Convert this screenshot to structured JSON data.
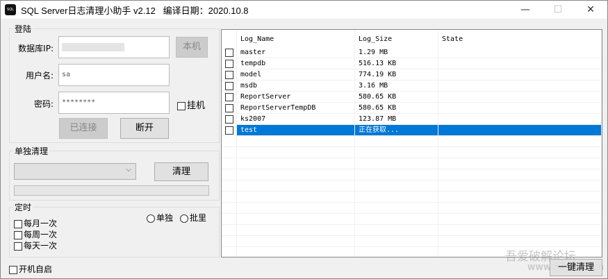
{
  "window": {
    "title": "SQL Server日志清理小助手 v2.12   编译日期：2020.10.8",
    "icon_text": "SQL",
    "minimize": "—",
    "maximize": "☐",
    "close": "✕"
  },
  "login": {
    "group": "登陆",
    "ip_label": "数据库IP:",
    "ip_value": "",
    "local_button": "本机",
    "user_label": "用户名:",
    "user_value": "sa",
    "pwd_label": "密码:",
    "pwd_value": "********",
    "hang_label": "挂机",
    "connected_button": "已连接",
    "disconnect_button": "断开"
  },
  "single": {
    "group": "单独清理",
    "select_value": "",
    "clean_button": "清理",
    "progress": 0
  },
  "timer": {
    "group": "定时",
    "monthly": "每月一次",
    "weekly": "每周一次",
    "daily": "每天一次",
    "radio_single": "单独",
    "radio_batch": "批里"
  },
  "autostart": "开机自启",
  "one_click_button": "一键清理",
  "watermark": "吾爱破解论坛 www.52pojie.cn",
  "list": {
    "columns": [
      "Log_Name",
      "Log_Size",
      "State"
    ],
    "rows": [
      {
        "name": "master",
        "size": "1.29 MB",
        "state": ""
      },
      {
        "name": "tempdb",
        "size": "516.13 KB",
        "state": ""
      },
      {
        "name": "model",
        "size": "774.19 KB",
        "state": ""
      },
      {
        "name": "msdb",
        "size": "3.16 MB",
        "state": ""
      },
      {
        "name": "ReportServer",
        "size": "580.65 KB",
        "state": ""
      },
      {
        "name": "ReportServerTempDB",
        "size": "580.65 KB",
        "state": ""
      },
      {
        "name": "ks2007",
        "size": "123.87 MB",
        "state": ""
      },
      {
        "name": "test",
        "size": "正在获取...",
        "state": "",
        "selected": true
      }
    ]
  }
}
